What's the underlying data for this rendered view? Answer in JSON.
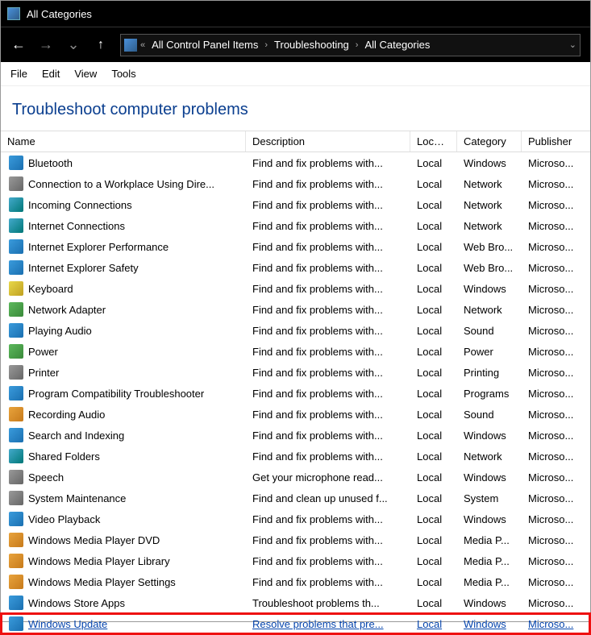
{
  "titlebar": {
    "title": "All Categories"
  },
  "nav": {
    "back": "←",
    "forward": "→",
    "dropdown": "⌄",
    "up": "↑"
  },
  "breadcrumb": {
    "prefix": "«",
    "items": [
      "All Control Panel Items",
      "Troubleshooting",
      "All Categories"
    ],
    "sep": "›"
  },
  "menu": {
    "file": "File",
    "edit": "Edit",
    "view": "View",
    "tools": "Tools"
  },
  "heading": "Troubleshoot computer problems",
  "columns": {
    "name": "Name",
    "desc": "Description",
    "loc": "Locat...",
    "cat": "Category",
    "pub": "Publisher"
  },
  "rows": [
    {
      "icon": "ic-blue",
      "name": "Bluetooth",
      "desc": "Find and fix problems with...",
      "loc": "Local",
      "cat": "Windows",
      "pub": "Microso..."
    },
    {
      "icon": "ic-gray",
      "name": "Connection to a Workplace Using Dire...",
      "desc": "Find and fix problems with...",
      "loc": "Local",
      "cat": "Network",
      "pub": "Microso..."
    },
    {
      "icon": "ic-teal",
      "name": "Incoming Connections",
      "desc": "Find and fix problems with...",
      "loc": "Local",
      "cat": "Network",
      "pub": "Microso..."
    },
    {
      "icon": "ic-teal",
      "name": "Internet Connections",
      "desc": "Find and fix problems with...",
      "loc": "Local",
      "cat": "Network",
      "pub": "Microso..."
    },
    {
      "icon": "ic-blue",
      "name": "Internet Explorer Performance",
      "desc": "Find and fix problems with...",
      "loc": "Local",
      "cat": "Web Bro...",
      "pub": "Microso..."
    },
    {
      "icon": "ic-blue",
      "name": "Internet Explorer Safety",
      "desc": "Find and fix problems with...",
      "loc": "Local",
      "cat": "Web Bro...",
      "pub": "Microso..."
    },
    {
      "icon": "ic-yellow",
      "name": "Keyboard",
      "desc": "Find and fix problems with...",
      "loc": "Local",
      "cat": "Windows",
      "pub": "Microso..."
    },
    {
      "icon": "ic-green",
      "name": "Network Adapter",
      "desc": "Find and fix problems with...",
      "loc": "Local",
      "cat": "Network",
      "pub": "Microso..."
    },
    {
      "icon": "ic-blue",
      "name": "Playing Audio",
      "desc": "Find and fix problems with...",
      "loc": "Local",
      "cat": "Sound",
      "pub": "Microso..."
    },
    {
      "icon": "ic-green",
      "name": "Power",
      "desc": "Find and fix problems with...",
      "loc": "Local",
      "cat": "Power",
      "pub": "Microso..."
    },
    {
      "icon": "ic-gray",
      "name": "Printer",
      "desc": "Find and fix problems with...",
      "loc": "Local",
      "cat": "Printing",
      "pub": "Microso..."
    },
    {
      "icon": "ic-blue",
      "name": "Program Compatibility Troubleshooter",
      "desc": "Find and fix problems with...",
      "loc": "Local",
      "cat": "Programs",
      "pub": "Microso..."
    },
    {
      "icon": "ic-orange",
      "name": "Recording Audio",
      "desc": "Find and fix problems with...",
      "loc": "Local",
      "cat": "Sound",
      "pub": "Microso..."
    },
    {
      "icon": "ic-blue",
      "name": "Search and Indexing",
      "desc": "Find and fix problems with...",
      "loc": "Local",
      "cat": "Windows",
      "pub": "Microso..."
    },
    {
      "icon": "ic-teal",
      "name": "Shared Folders",
      "desc": "Find and fix problems with...",
      "loc": "Local",
      "cat": "Network",
      "pub": "Microso..."
    },
    {
      "icon": "ic-gray",
      "name": "Speech",
      "desc": "Get your microphone read...",
      "loc": "Local",
      "cat": "Windows",
      "pub": "Microso..."
    },
    {
      "icon": "ic-gray",
      "name": "System Maintenance",
      "desc": "Find and clean up unused f...",
      "loc": "Local",
      "cat": "System",
      "pub": "Microso..."
    },
    {
      "icon": "ic-blue",
      "name": "Video Playback",
      "desc": "Find and fix problems with...",
      "loc": "Local",
      "cat": "Windows",
      "pub": "Microso..."
    },
    {
      "icon": "ic-orange",
      "name": "Windows Media Player DVD",
      "desc": "Find and fix problems with...",
      "loc": "Local",
      "cat": "Media P...",
      "pub": "Microso..."
    },
    {
      "icon": "ic-orange",
      "name": "Windows Media Player Library",
      "desc": "Find and fix problems with...",
      "loc": "Local",
      "cat": "Media P...",
      "pub": "Microso..."
    },
    {
      "icon": "ic-orange",
      "name": "Windows Media Player Settings",
      "desc": "Find and fix problems with...",
      "loc": "Local",
      "cat": "Media P...",
      "pub": "Microso..."
    },
    {
      "icon": "ic-blue",
      "name": "Windows Store Apps",
      "desc": "Troubleshoot problems th...",
      "loc": "Local",
      "cat": "Windows",
      "pub": "Microso..."
    },
    {
      "icon": "ic-blue",
      "name": "Windows Update",
      "desc": "Resolve problems that pre...",
      "loc": "Local",
      "cat": "Windows",
      "pub": "Microso...",
      "highlighted": true
    }
  ]
}
